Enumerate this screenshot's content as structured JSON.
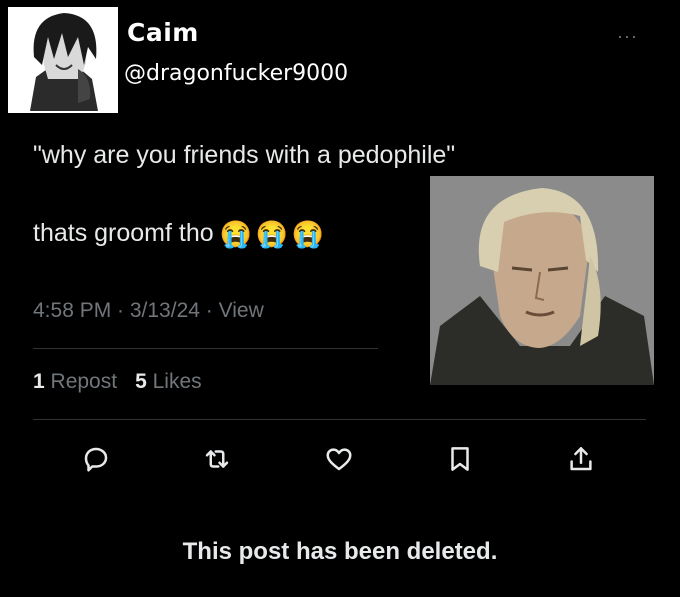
{
  "user": {
    "display_name": "Caim",
    "handle": "@dragonfucker9000",
    "more_label": "···"
  },
  "post": {
    "quote_text": "\"why are you friends with a pedophile\"",
    "reply_text": "thats groomf tho",
    "reply_emojis": [
      "😭",
      "😭",
      "😭"
    ],
    "meta_text": "4:58 PM · 3/13/24 · View",
    "stats": {
      "reposts_count": "1",
      "reposts_label": "Repost",
      "likes_count": "5",
      "likes_label": "Likes"
    }
  },
  "actions": [
    {
      "name": "reply-icon"
    },
    {
      "name": "repost-icon"
    },
    {
      "name": "like-icon"
    },
    {
      "name": "bookmark-icon"
    },
    {
      "name": "share-icon"
    }
  ],
  "footer": {
    "deleted_text": "This post has been deleted."
  },
  "colors": {
    "background": "#000000",
    "text": "#e7e9ea",
    "muted": "#71767b",
    "divider": "#2f3336"
  }
}
